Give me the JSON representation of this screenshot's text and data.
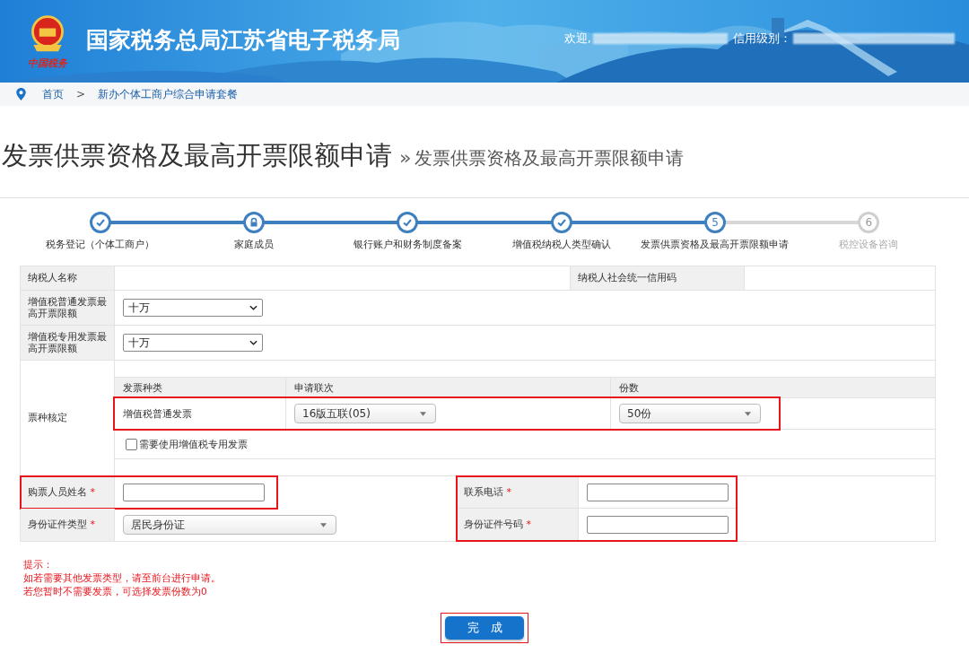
{
  "header": {
    "site_title": "国家税务总局江苏省电子税务局",
    "logo_caption": "中国税务",
    "welcome": "欢迎,",
    "credit_label": "信用级别："
  },
  "breadcrumb": [
    {
      "label": "首页",
      "kind": "link"
    },
    {
      "label": ">",
      "kind": "separator"
    },
    {
      "label": "新办个体工商户综合申请套餐",
      "kind": "link"
    }
  ],
  "page_title": {
    "main": "发票供票资格及最高开票限额申请",
    "arrow": "»",
    "sub": "发票供票资格及最高开票限额申请"
  },
  "steps": [
    {
      "label": "税务登记（个体工商户）",
      "kind": "check",
      "reached": true
    },
    {
      "label": "家庭成员",
      "kind": "lock",
      "reached": true
    },
    {
      "label": "银行账户和财务制度备案",
      "kind": "check",
      "reached": true
    },
    {
      "label": "增值税纳税人类型确认",
      "kind": "check",
      "reached": true
    },
    {
      "label": "发票供票资格及最高开票限额申请",
      "kind": "number",
      "number": "5",
      "reached": true
    },
    {
      "label": "税控设备咨询",
      "kind": "number",
      "number": "6",
      "reached": false
    }
  ],
  "form": {
    "taxpayer_name_label": "纳税人名称",
    "credit_code_label": "纳税人社会统一信用码",
    "limit_rows": [
      {
        "label": "增值税普通发票最高开票限额",
        "value": "十万"
      },
      {
        "label": "增值税专用发票最高开票限额",
        "value": "十万"
      }
    ],
    "invoice_section": {
      "label": "票种核定",
      "columns": [
        "发票种类",
        "申请联次",
        "份数"
      ],
      "rows": [
        {
          "type": "增值税普通发票",
          "copies": "16版五联(05)",
          "count": "50份",
          "highlighted": true
        }
      ],
      "special_invoice": {
        "label": "需要使用增值税专用发票",
        "checked": false
      }
    },
    "buyer_name": {
      "label": "购票人员姓名",
      "required_mark": "*",
      "highlighted": true
    },
    "id_type": {
      "label": "身份证件类型",
      "required_mark": "*",
      "value": "居民身份证"
    },
    "contact_block": {
      "highlighted": true,
      "fields": [
        {
          "label": "联系电话",
          "required_mark": "*"
        },
        {
          "label": "身份证件号码",
          "required_mark": "*"
        }
      ]
    }
  },
  "hints": [
    "提示：",
    "如若需要其他发票类型，请至前台进行申请。",
    "若您暂时不需要发票，可选择发票份数为0"
  ],
  "submit": {
    "label": "完　成",
    "highlighted": true
  }
}
